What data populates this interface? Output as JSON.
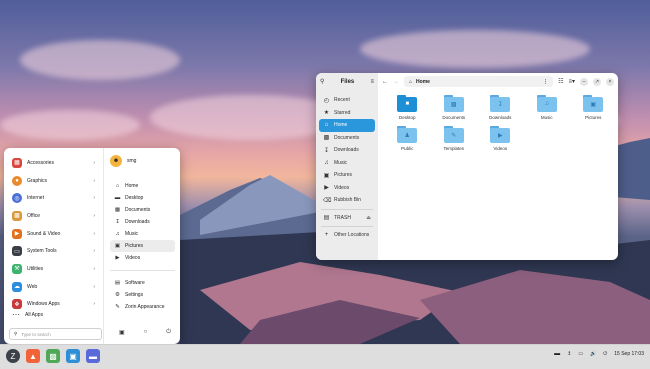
{
  "files_window": {
    "title": "Files",
    "location": "Home",
    "sidebar": [
      {
        "label": "Recent",
        "icon": "clock-icon"
      },
      {
        "label": "Starred",
        "icon": "star-icon"
      },
      {
        "label": "Home",
        "icon": "home-icon",
        "active": true
      },
      {
        "label": "Documents",
        "icon": "document-icon"
      },
      {
        "label": "Downloads",
        "icon": "download-icon"
      },
      {
        "label": "Music",
        "icon": "music-icon"
      },
      {
        "label": "Pictures",
        "icon": "picture-icon"
      },
      {
        "label": "Videos",
        "icon": "video-icon"
      },
      {
        "label": "Rubbish Bin",
        "icon": "trash-icon"
      },
      {
        "label": "TRASH",
        "icon": "drive-icon"
      },
      {
        "label": "Other Locations",
        "icon": "plus-icon"
      }
    ],
    "folders": [
      {
        "label": "Desktop"
      },
      {
        "label": "Documents"
      },
      {
        "label": "Downloads"
      },
      {
        "label": "Music"
      },
      {
        "label": "Pictures"
      },
      {
        "label": "Public"
      },
      {
        "label": "Templates"
      },
      {
        "label": "Videos"
      }
    ]
  },
  "menu": {
    "categories": [
      {
        "label": "Accessories",
        "icon": "toolbox-icon",
        "color": "#d9453f"
      },
      {
        "label": "Graphics",
        "icon": "palette-icon",
        "color": "#e98a2e"
      },
      {
        "label": "Internet",
        "icon": "globe-icon",
        "color": "#4a6ed6"
      },
      {
        "label": "Office",
        "icon": "briefcase-icon",
        "color": "#d9983a"
      },
      {
        "label": "Sound & Video",
        "icon": "media-icon",
        "color": "#e2711d"
      },
      {
        "label": "System Tools",
        "icon": "terminal-icon",
        "color": "#3a3f47"
      },
      {
        "label": "Utilities",
        "icon": "utilities-icon",
        "color": "#3bb36f"
      },
      {
        "label": "Web",
        "icon": "cloud-icon",
        "color": "#2b8fe0"
      },
      {
        "label": "Windows Apps",
        "icon": "windows-icon",
        "color": "#c93939"
      }
    ],
    "all_apps": "All Apps",
    "search_placeholder": "Type to search",
    "user": "smg",
    "places": [
      {
        "label": "Home",
        "icon": "home-icon"
      },
      {
        "label": "Desktop",
        "icon": "desktop-icon"
      },
      {
        "label": "Documents",
        "icon": "document-icon"
      },
      {
        "label": "Downloads",
        "icon": "download-icon"
      },
      {
        "label": "Music",
        "icon": "music-icon"
      },
      {
        "label": "Pictures",
        "icon": "picture-icon",
        "selected": true
      },
      {
        "label": "Videos",
        "icon": "video-icon"
      }
    ],
    "system": [
      {
        "label": "Software",
        "icon": "software-icon"
      },
      {
        "label": "Settings",
        "icon": "gear-icon"
      },
      {
        "label": "Zorin Appearance",
        "icon": "appearance-icon"
      }
    ]
  },
  "taskbar": {
    "clock": "15 Sep 17:03"
  },
  "colors": {
    "accent": "#2a96dc",
    "folder": "#7cc2ef"
  }
}
